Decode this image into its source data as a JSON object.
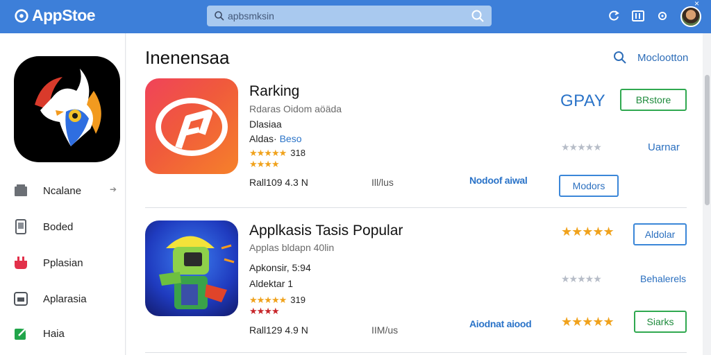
{
  "app": {
    "title": "AppStoe"
  },
  "search": {
    "placeholder": "apbsmksin"
  },
  "window": {
    "close_label": "×"
  },
  "sidebar": {
    "items": [
      {
        "label": "Ncalane",
        "icon": "store-icon",
        "pin": "➔"
      },
      {
        "label": "Boded",
        "icon": "device-icon"
      },
      {
        "label": "Pplasian",
        "icon": "plug-icon"
      },
      {
        "label": "Aplarasia",
        "icon": "folder-icon"
      },
      {
        "label": "Haia",
        "icon": "share-icon"
      }
    ]
  },
  "main": {
    "title": "Inenensaa",
    "filter_label": "Moclootton",
    "apps": [
      {
        "title": "Rarking",
        "subtitle": "Rdaras Oidom aöäda",
        "line1": "Dlasiaa",
        "line2_label": "Aldas·",
        "line2_value": "Beso",
        "rating1": "318",
        "rating_count": 4,
        "footer_left": "Rall109 4.3 N",
        "footer_mid": "Ill/lus",
        "link": "Nodoof aiwal",
        "brand": "GPAY",
        "primary_button": "BRstore",
        "right_label": "Uarnar",
        "secondary_button": "Modors",
        "grey_rating": 4
      },
      {
        "title": "Applkasis Tasis Popular",
        "subtitle": "Applas bldapn 40lin",
        "line1": "Apkonsir, 5:94",
        "line2_label": "Aldektar",
        "line2_value": "1",
        "rating1": "319",
        "rating_count": 4,
        "footer_left": "Rall129 4.9 N",
        "footer_mid": "IIM/us",
        "link": "Aiodnat aiood",
        "primary_button": "Aldolar",
        "right_label": "Behalerels",
        "secondary_button": "Siarks",
        "top_rating": 5,
        "grey_rating": 4,
        "bottom_rating": 4
      }
    ]
  },
  "colors": {
    "topbar": "#3d7fd9",
    "accent_blue": "#2a73c8",
    "green": "#2fa84f",
    "star": "#f0a21c"
  }
}
